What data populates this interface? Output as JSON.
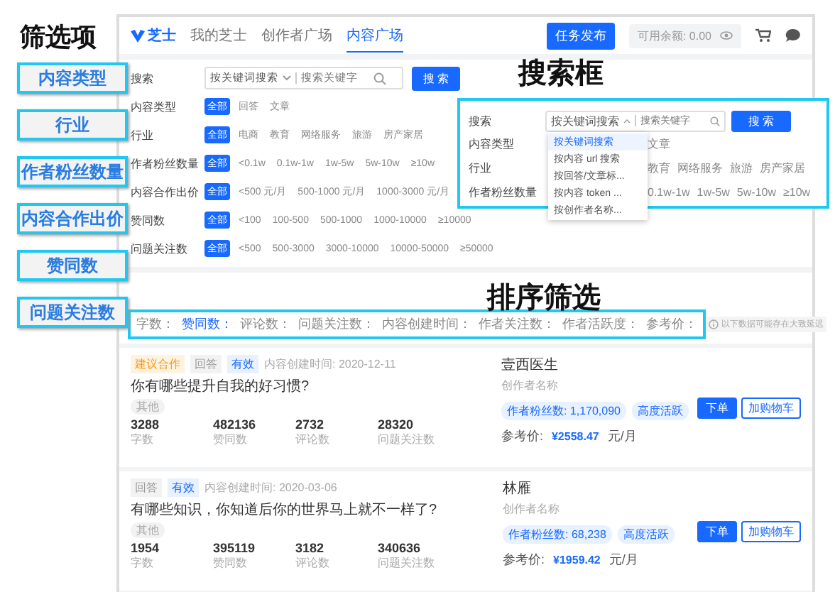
{
  "annotations": {
    "filters_title": "筛选项",
    "filter_tags": [
      "内容类型",
      "行业",
      "作者粉丝数量",
      "内容合作出价",
      "赞同数",
      "问题关注数"
    ],
    "search_title": "搜索框",
    "sort_title": "排序筛选"
  },
  "header": {
    "logo": "芝士",
    "nav": [
      {
        "label": "我的芝士",
        "selected": false
      },
      {
        "label": "创作者广场",
        "selected": false
      },
      {
        "label": "内容广场",
        "selected": true
      }
    ],
    "publish_button": "任务发布",
    "balance": "可用余额: 0.00"
  },
  "search": {
    "label": "搜索",
    "scope": "按关键词搜索",
    "placeholder": "搜索关键字",
    "button": "搜 索"
  },
  "filters": [
    {
      "label": "内容类型",
      "options": [
        {
          "label": "全部",
          "selected": true
        },
        {
          "label": "回答",
          "selected": false
        },
        {
          "label": "文章",
          "selected": false
        }
      ]
    },
    {
      "label": "行业",
      "options": [
        {
          "label": "全部",
          "selected": true
        },
        {
          "label": "电商",
          "selected": false
        },
        {
          "label": "教育",
          "selected": false
        },
        {
          "label": "网络服务",
          "selected": false
        },
        {
          "label": "旅游",
          "selected": false
        },
        {
          "label": "房产家居",
          "selected": false
        }
      ]
    },
    {
      "label": "作者粉丝数量",
      "options": [
        {
          "label": "全部",
          "selected": true
        },
        {
          "label": "<0.1w",
          "selected": false
        },
        {
          "label": "0.1w-1w",
          "selected": false
        },
        {
          "label": "1w-5w",
          "selected": false
        },
        {
          "label": "5w-10w",
          "selected": false
        },
        {
          "label": "≥10w",
          "selected": false
        }
      ]
    },
    {
      "label": "内容合作出价",
      "options": [
        {
          "label": "全部",
          "selected": true
        },
        {
          "label": "<500 元/月",
          "selected": false
        },
        {
          "label": "500-1000 元/月",
          "selected": false
        },
        {
          "label": "1000-3000 元/月",
          "selected": false
        }
      ]
    },
    {
      "label": "赞同数",
      "options": [
        {
          "label": "全部",
          "selected": true
        },
        {
          "label": "<100",
          "selected": false
        },
        {
          "label": "100-500",
          "selected": false
        },
        {
          "label": "500-1000",
          "selected": false
        },
        {
          "label": "1000-10000",
          "selected": false
        },
        {
          "label": "≥10000",
          "selected": false
        }
      ]
    },
    {
      "label": "问题关注数",
      "options": [
        {
          "label": "全部",
          "selected": true
        },
        {
          "label": "<500",
          "selected": false
        },
        {
          "label": "500-3000",
          "selected": false
        },
        {
          "label": "3000-10000",
          "selected": false
        },
        {
          "label": "10000-50000",
          "selected": false
        },
        {
          "label": "≥50000",
          "selected": false
        }
      ]
    }
  ],
  "sort": {
    "options": [
      {
        "label": "字数：",
        "selected": false
      },
      {
        "label": "赞同数：",
        "selected": true
      },
      {
        "label": "评论数：",
        "selected": false
      },
      {
        "label": "问题关注数：",
        "selected": false
      },
      {
        "label": "内容创建时间：",
        "selected": false
      },
      {
        "label": "作者关注数：",
        "selected": false
      },
      {
        "label": "作者活跃度：",
        "selected": false
      },
      {
        "label": "参考价：",
        "selected": false
      }
    ],
    "note": "以下数据可能存在大致延迟"
  },
  "items": [
    {
      "tags": [
        {
          "label": "建议合作",
          "kind": "suggest"
        },
        {
          "label": "回答",
          "kind": "type"
        },
        {
          "label": "有效",
          "kind": "valid"
        }
      ],
      "created": "内容创建时间: 2020-12-11",
      "title": "你有哪些提升自我的好习惯?",
      "category": "其他",
      "stats": [
        {
          "value": "3288",
          "label": "字数"
        },
        {
          "value": "482136",
          "label": "赞同数"
        },
        {
          "value": "2732",
          "label": "评论数"
        },
        {
          "value": "28320",
          "label": "问题关注数"
        }
      ],
      "author": "壹西医生",
      "author_caption": "创作者名称",
      "chips": [
        "作者粉丝数: 1,170,090",
        "高度活跃"
      ],
      "price_label": "参考价:",
      "price": "¥2558.47",
      "price_unit": "元/月",
      "buttons": [
        "下单",
        "加购物车"
      ]
    },
    {
      "tags": [
        {
          "label": "回答",
          "kind": "type"
        },
        {
          "label": "有效",
          "kind": "valid"
        }
      ],
      "created": "内容创建时间: 2020-03-06",
      "title": "有哪些知识，你知道后你的世界马上就不一样了?",
      "category": "其他",
      "stats": [
        {
          "value": "1954",
          "label": "字数"
        },
        {
          "value": "395119",
          "label": "赞同数"
        },
        {
          "value": "3182",
          "label": "评论数"
        },
        {
          "value": "340636",
          "label": "问题关注数"
        }
      ],
      "author": "林雁",
      "author_caption": "创作者名称",
      "chips": [
        "作者粉丝数: 68,238",
        "高度活跃"
      ],
      "price_label": "参考价:",
      "price": "¥1959.42",
      "price_unit": "元/月",
      "buttons": [
        "下单",
        "加购物车"
      ]
    }
  ],
  "overlay": {
    "label": "搜索",
    "scope": "按关键词搜索",
    "placeholder": "搜索关键字",
    "button": "搜 索",
    "dropdown": [
      {
        "label": "按关键词搜索",
        "selected": true
      },
      {
        "label": "按内容 url 搜索",
        "selected": false
      },
      {
        "label": "按回答/文章标...",
        "selected": false
      },
      {
        "label": "按内容 token ...",
        "selected": false
      },
      {
        "label": "按创作者名称...",
        "selected": false
      }
    ],
    "rows": [
      {
        "label": "内容类型",
        "options": [
          "文章"
        ]
      },
      {
        "label": "行业",
        "options": [
          "教育",
          "网络服务",
          "旅游",
          "房产家居"
        ]
      },
      {
        "label": "作者粉丝数量",
        "options": [
          "0.1w-1w",
          "1w-5w",
          "5w-10w",
          "≥10w"
        ]
      }
    ]
  }
}
